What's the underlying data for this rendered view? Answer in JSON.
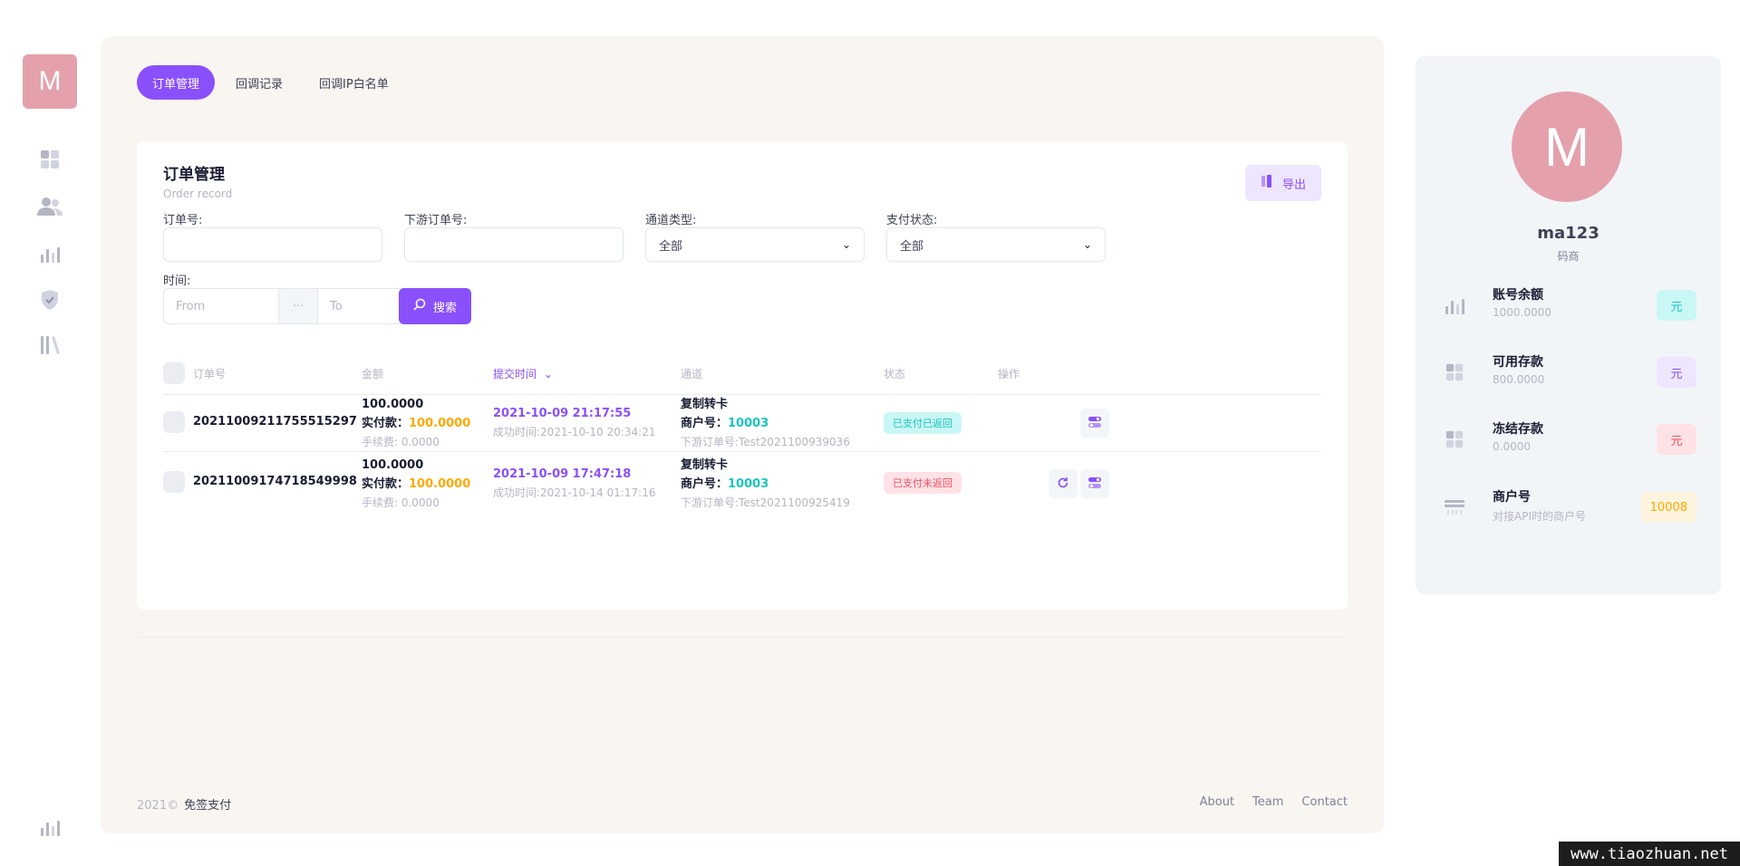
{
  "rail": {
    "logo_letter": "M",
    "icons": [
      "dashboard-icon",
      "users-icon",
      "bar-chart-icon",
      "shield-check-icon",
      "library-icon"
    ],
    "bottom_icon": "bar-chart-icon"
  },
  "tabs": [
    {
      "label": "订单管理",
      "active": true
    },
    {
      "label": "回调记录",
      "active": false
    },
    {
      "label": "回调IP白名单",
      "active": false
    }
  ],
  "card": {
    "title": "订单管理",
    "subtitle": "Order record",
    "export_label": "导出"
  },
  "filters": {
    "order_no_label": "订单号:",
    "order_no_value": "",
    "downstream_label": "下游订单号:",
    "downstream_value": "",
    "channel_label": "通道类型:",
    "channel_value": "全部",
    "pay_status_label": "支付状态:",
    "pay_status_value": "全部",
    "time_label": "时间:",
    "from_placeholder": "From",
    "range_sep": "···",
    "to_placeholder": "To",
    "search_label": "搜索"
  },
  "table": {
    "columns": [
      "订单号",
      "金额",
      "提交时间",
      "通道",
      "状态",
      "操作"
    ],
    "sort_indicator": "⌄",
    "rows": [
      {
        "order_no": "20211009211755515297",
        "amount": "100.0000",
        "actual_label": "实付款：",
        "actual_value": "100.0000",
        "fee": "手续费: 0.0000",
        "submit_time": "2021-10-09 21:17:55",
        "success_time": "成功时间:2021-10-10 20:34:21",
        "channel": "复制转卡",
        "merchant_label": "商户号：",
        "merchant_no": "10003",
        "downstream_no": "下游订单号:Test2021100939036",
        "status": "已支付已返回"
      },
      {
        "order_no": "20211009174718549998",
        "amount": "100.0000",
        "actual_label": "实付款：",
        "actual_value": "100.0000",
        "fee": "手续费: 0.0000",
        "submit_time": "2021-10-09 17:47:18",
        "success_time": "成功时间:2021-10-14 01:17:16",
        "channel": "复制转卡",
        "merchant_label": "商户号：",
        "merchant_no": "10003",
        "downstream_no": "下游订单号:Test2021100925419",
        "status": "已支付未返回"
      }
    ]
  },
  "footer": {
    "year": "2021©",
    "brand": "免签支付",
    "links": [
      "About",
      "Team",
      "Contact"
    ]
  },
  "profile": {
    "avatar_letter": "M",
    "name": "ma123",
    "role": "码商",
    "items": [
      {
        "title": "账号余额",
        "value": "1000.0000",
        "badge": "元",
        "icon": "bar-chart-icon"
      },
      {
        "title": "可用存款",
        "value": "800.0000",
        "badge": "元",
        "icon": "dashboard-icon"
      },
      {
        "title": "冻结存款",
        "value": "0.0000",
        "badge": "元",
        "icon": "dashboard-icon"
      },
      {
        "title": "商户号",
        "value": "对接API时的商户号",
        "badge": "10008",
        "icon": "server-icon"
      }
    ]
  },
  "watermark": "www.tiaozhuan.net",
  "colors": {
    "primary": "#8950fc",
    "success": "#1bc5bd",
    "danger": "#f64e60",
    "warning": "#ffa800",
    "logo": "#e4a1ac"
  }
}
